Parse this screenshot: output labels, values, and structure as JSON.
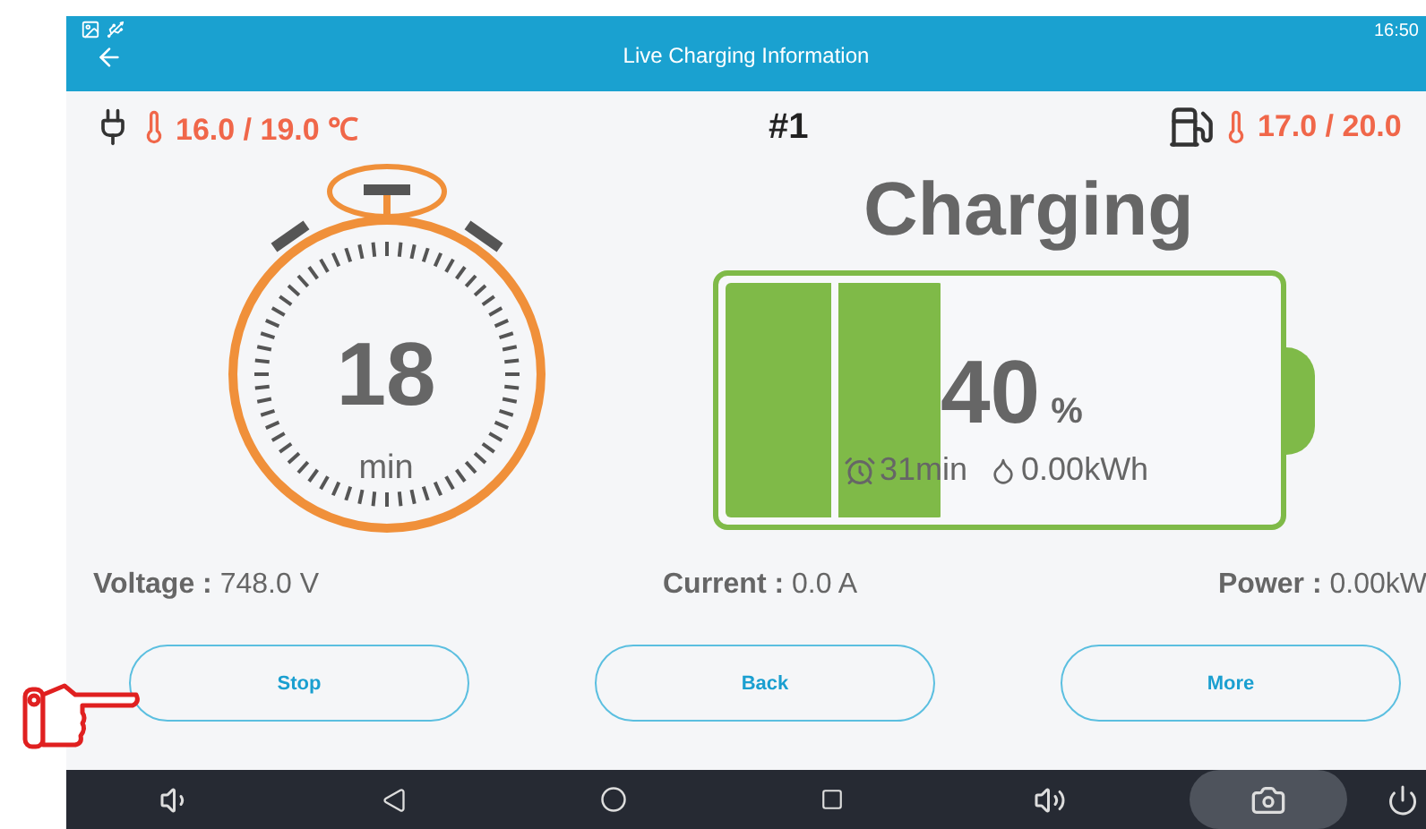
{
  "status_bar": {
    "time": "16:50"
  },
  "app_bar": {
    "title": "Live Charging Information"
  },
  "connector_temp": "16.0 / 19.0 ℃",
  "charger_id": "#1",
  "charger_temp": "17.0 / 20.0",
  "timer": {
    "value": "18",
    "unit": "min"
  },
  "status": "Charging",
  "battery": {
    "level": 0.4,
    "percent": "40",
    "percent_unit": "%",
    "time": "31min",
    "energy": "0.00kWh"
  },
  "readings": [
    {
      "label": "Voltage :",
      "value": "748.0 V"
    },
    {
      "label": "Current :",
      "value": "0.0 A"
    },
    {
      "label": "Power :",
      "value": "0.00kW"
    }
  ],
  "buttons": [
    "Stop",
    "Back",
    "More"
  ]
}
